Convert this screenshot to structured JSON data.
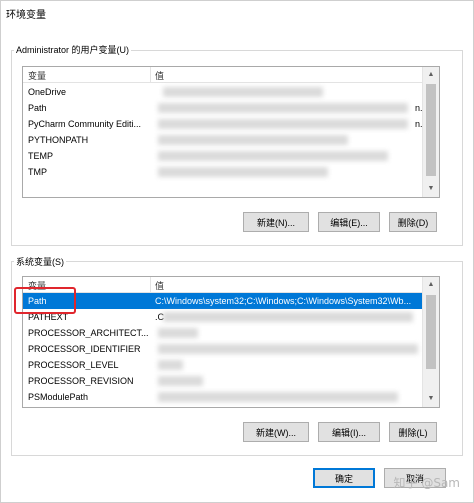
{
  "window": {
    "title": "环境变量"
  },
  "user_vars": {
    "group_label": "Administrator 的用户变量(U)",
    "columns": [
      "变量",
      "值"
    ],
    "rows": [
      {
        "name": "OneDrive",
        "value": ""
      },
      {
        "name": "Path",
        "value": "n..."
      },
      {
        "name": "PyCharm Community Editi...",
        "value": "n..."
      },
      {
        "name": "PYTHONPATH",
        "value": ""
      },
      {
        "name": "TEMP",
        "value": ""
      },
      {
        "name": "TMP",
        "value": ""
      }
    ],
    "buttons": {
      "new": "新建(N)...",
      "edit": "编辑(E)...",
      "delete": "删除(D)"
    }
  },
  "system_vars": {
    "group_label": "系统变量(S)",
    "columns": [
      "变量",
      "值"
    ],
    "rows": [
      {
        "name": "Path",
        "value": "C:\\Windows\\system32;C:\\Windows;C:\\Windows\\System32\\Wb...",
        "selected": true
      },
      {
        "name": "PATHEXT",
        "value": ".C"
      },
      {
        "name": "PROCESSOR_ARCHITECT...",
        "value": ""
      },
      {
        "name": "PROCESSOR_IDENTIFIER",
        "value": ""
      },
      {
        "name": "PROCESSOR_LEVEL",
        "value": ""
      },
      {
        "name": "PROCESSOR_REVISION",
        "value": ""
      },
      {
        "name": "PSModulePath",
        "value": ""
      }
    ],
    "buttons": {
      "new": "新建(W)...",
      "edit": "编辑(I)...",
      "delete": "删除(L)"
    }
  },
  "footer": {
    "ok": "确定",
    "cancel": "取消"
  },
  "watermark": "知乎 @Sam"
}
